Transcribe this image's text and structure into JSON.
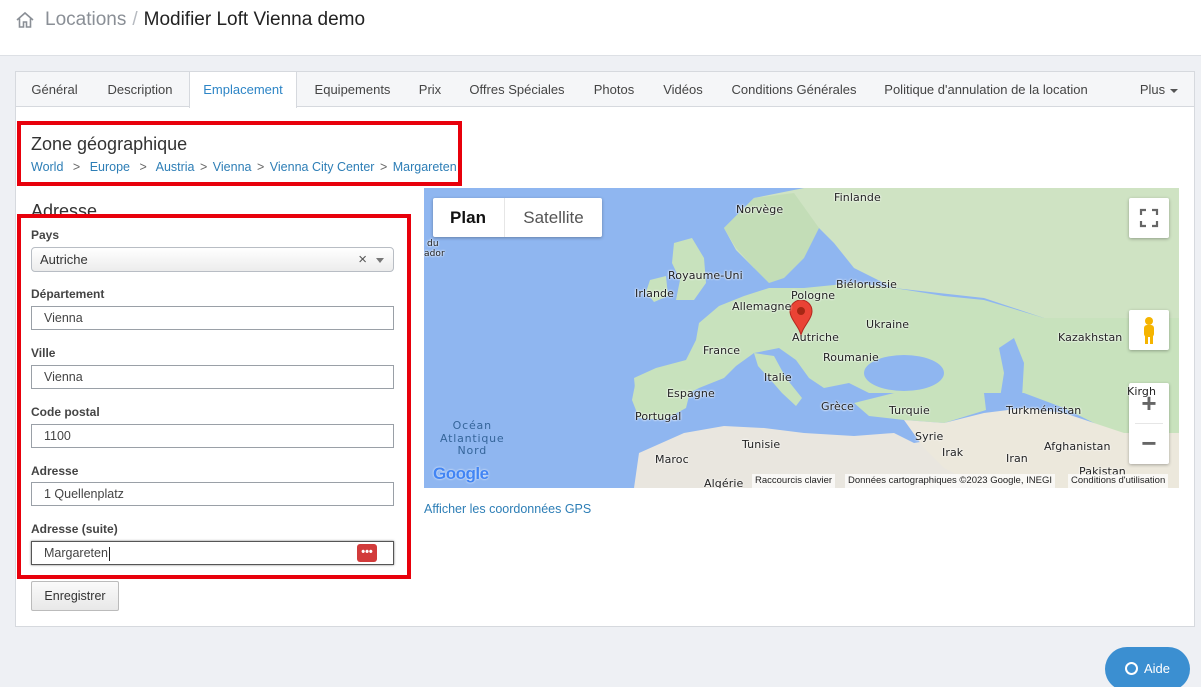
{
  "header": {
    "breadcrumb_root": "Locations",
    "breadcrumb_sep": "/",
    "page_title": "Modifier Loft Vienna demo"
  },
  "tabs": [
    {
      "label": "Général"
    },
    {
      "label": "Description"
    },
    {
      "label": "Emplacement",
      "active": true
    },
    {
      "label": "Equipements"
    },
    {
      "label": "Prix"
    },
    {
      "label": "Offres Spéciales"
    },
    {
      "label": "Photos"
    },
    {
      "label": "Vidéos"
    },
    {
      "label": "Conditions Générales"
    },
    {
      "label": "Politique d'annulation de la location"
    },
    {
      "label": "Plus"
    }
  ],
  "zone": {
    "title": "Zone géographique",
    "path": [
      "World",
      "Europe",
      "Austria",
      "Vienna",
      "Vienna City Center",
      "Margareten"
    ],
    "sep": ">"
  },
  "address": {
    "title": "Adresse",
    "country_label": "Pays",
    "country_value": "Autriche",
    "clear_glyph": "×",
    "department_label": "Département",
    "department_value": "Vienna",
    "city_label": "Ville",
    "city_value": "Vienna",
    "postal_label": "Code postal",
    "postal_value": "1100",
    "address_label": "Adresse",
    "address_value": "1 Quellenplatz",
    "address2_label": "Adresse (suite)",
    "address2_value": "Margareten",
    "password_icon_glyph": "•••"
  },
  "save_button": "Enregistrer",
  "map": {
    "type_plan": "Plan",
    "type_satellite": "Satellite",
    "labels": {
      "finlande": "Finlande",
      "norvege": "Norvège",
      "royaume_uni": "Royaume-Uni",
      "irlande": "Irlande",
      "bielorussie": "Biélorussie",
      "pologne": "Pologne",
      "allemagne": "Allemagne",
      "ukraine": "Ukraine",
      "kazakhstan": "Kazakhstan",
      "france": "France",
      "autriche": "Autriche",
      "roumanie": "Roumanie",
      "italie": "Italie",
      "espagne": "Espagne",
      "grece": "Grèce",
      "turquie": "Turquie",
      "turkmenistan": "Turkménistan",
      "kirgh": "Kirgh",
      "portugal": "Portugal",
      "tunisie": "Tunisie",
      "syrie": "Syrie",
      "irak": "Irak",
      "iran": "Iran",
      "afghanistan": "Afghanistan",
      "maroc": "Maroc",
      "algerie": "Algérie",
      "pakistan": "Pakistan",
      "du": "du",
      "ador": "ador",
      "ocean_1": "Océan",
      "ocean_2": "Atlantique",
      "ocean_3": "Nord"
    },
    "google_logo": "Google",
    "attr_shortcuts": "Raccourcis clavier",
    "attr_data": "Données cartographiques ©2023 Google, INEGI",
    "attr_terms": "Conditions d'utilisation",
    "zoom_in": "+",
    "zoom_out": "−"
  },
  "gps_link": "Afficher les coordonnées GPS",
  "help_button": "Aide",
  "colors": {
    "accent": "#2d85c6",
    "highlight_box": "#e8000b",
    "help_button": "#3b8fd1",
    "land": "#c8e2bd",
    "water": "#8fb6f0"
  }
}
